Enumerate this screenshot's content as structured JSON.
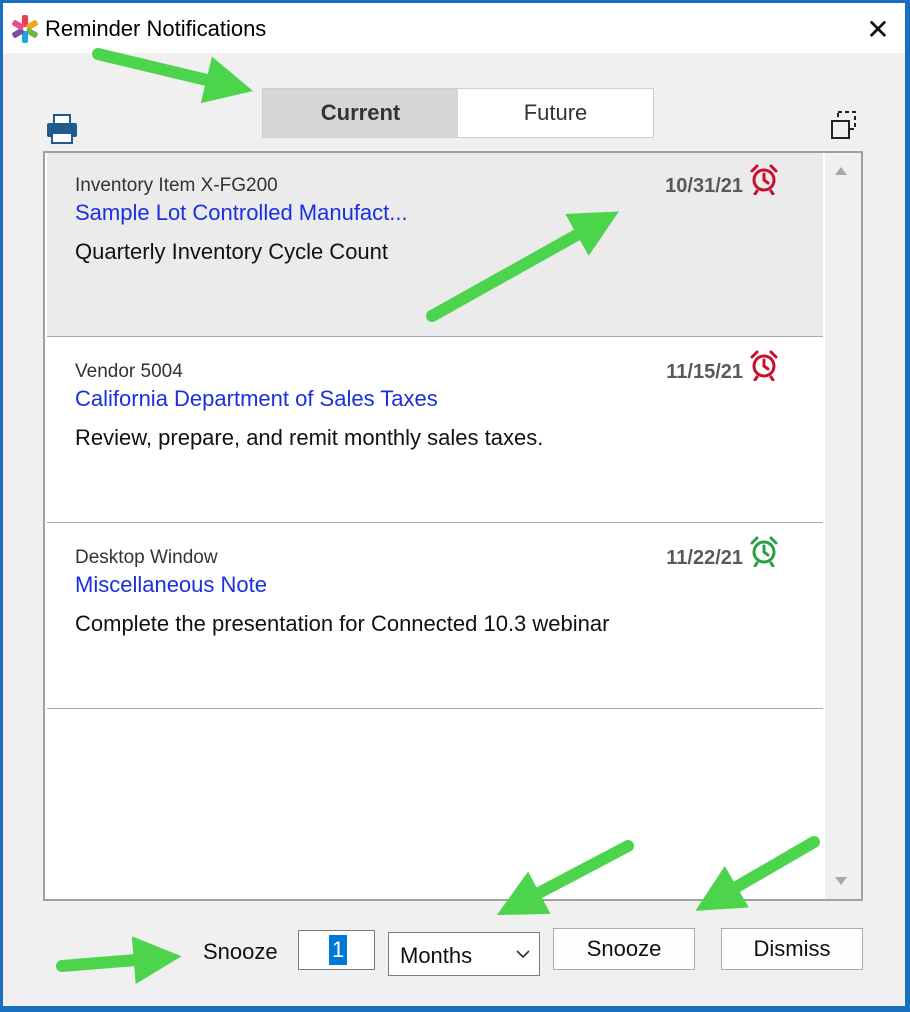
{
  "window": {
    "title": "Reminder Notifications",
    "close_glyph": "✕"
  },
  "tabs": [
    {
      "label": "Current",
      "active": true
    },
    {
      "label": "Future",
      "active": false
    }
  ],
  "reminders": [
    {
      "source": "Inventory Item X-FG200",
      "link": "Sample Lot Controlled Manufact...",
      "description": "Quarterly Inventory Cycle Count",
      "date": "10/31/21",
      "alarm_color": "#c8102e",
      "selected": true
    },
    {
      "source": "Vendor 5004",
      "link": "California Department of Sales Taxes",
      "description": "Review, prepare, and remit monthly sales taxes.",
      "date": "11/15/21",
      "alarm_color": "#c8102e",
      "selected": false
    },
    {
      "source": "Desktop Window",
      "link": "Miscellaneous Note",
      "description": "Complete the presentation for Connected 10.3 webinar",
      "date": "11/22/21",
      "alarm_color": "#2ea043",
      "selected": false
    }
  ],
  "footer": {
    "snooze_label": "Snooze",
    "snooze_value": "1",
    "unit_value": "Months",
    "snooze_button": "Snooze",
    "dismiss_button": "Dismiss"
  },
  "colors": {
    "link": "#1a2fe0",
    "annotation_arrow": "#4cd44c",
    "selection_highlight": "#0078d7"
  },
  "icons": {
    "app": "app-logo-icon",
    "print": "printer-icon",
    "popout": "popout-window-icon",
    "alarm": "alarm-clock-icon",
    "chevron": "chevron-down-icon"
  }
}
